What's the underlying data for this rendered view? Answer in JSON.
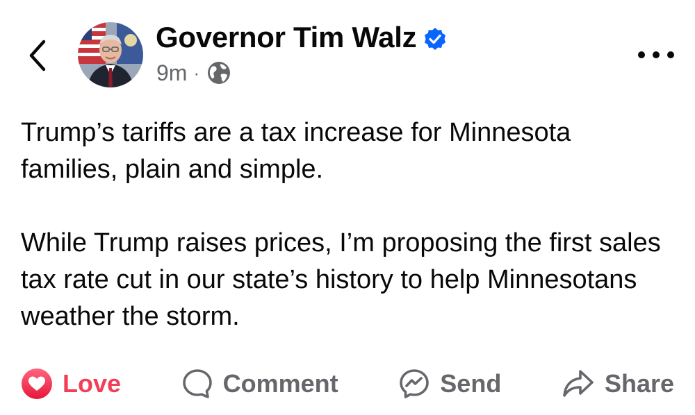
{
  "header": {
    "back_icon": "chevron-left-icon",
    "author_name": "Governor Tim Walz",
    "verified_icon": "verified-badge-icon",
    "timestamp": "9m",
    "separator": "·",
    "audience_icon": "globe-icon",
    "more_icon": "more-horizontal-icon"
  },
  "post": {
    "paragraphs": [
      "Trump’s tariffs are a tax increase for Minnesota families, plain and simple.",
      "While Trump raises prices, I’m proposing the first sales tax rate cut in our state’s history to help Minnesotans weather the storm."
    ]
  },
  "actions": {
    "love_label": "Love",
    "comment_label": "Comment",
    "send_label": "Send",
    "share_label": "Share"
  },
  "colors": {
    "love_accent": "#f33e58",
    "verified_blue": "#0866ff",
    "secondary_text": "#65676b",
    "primary_text": "#080809"
  }
}
